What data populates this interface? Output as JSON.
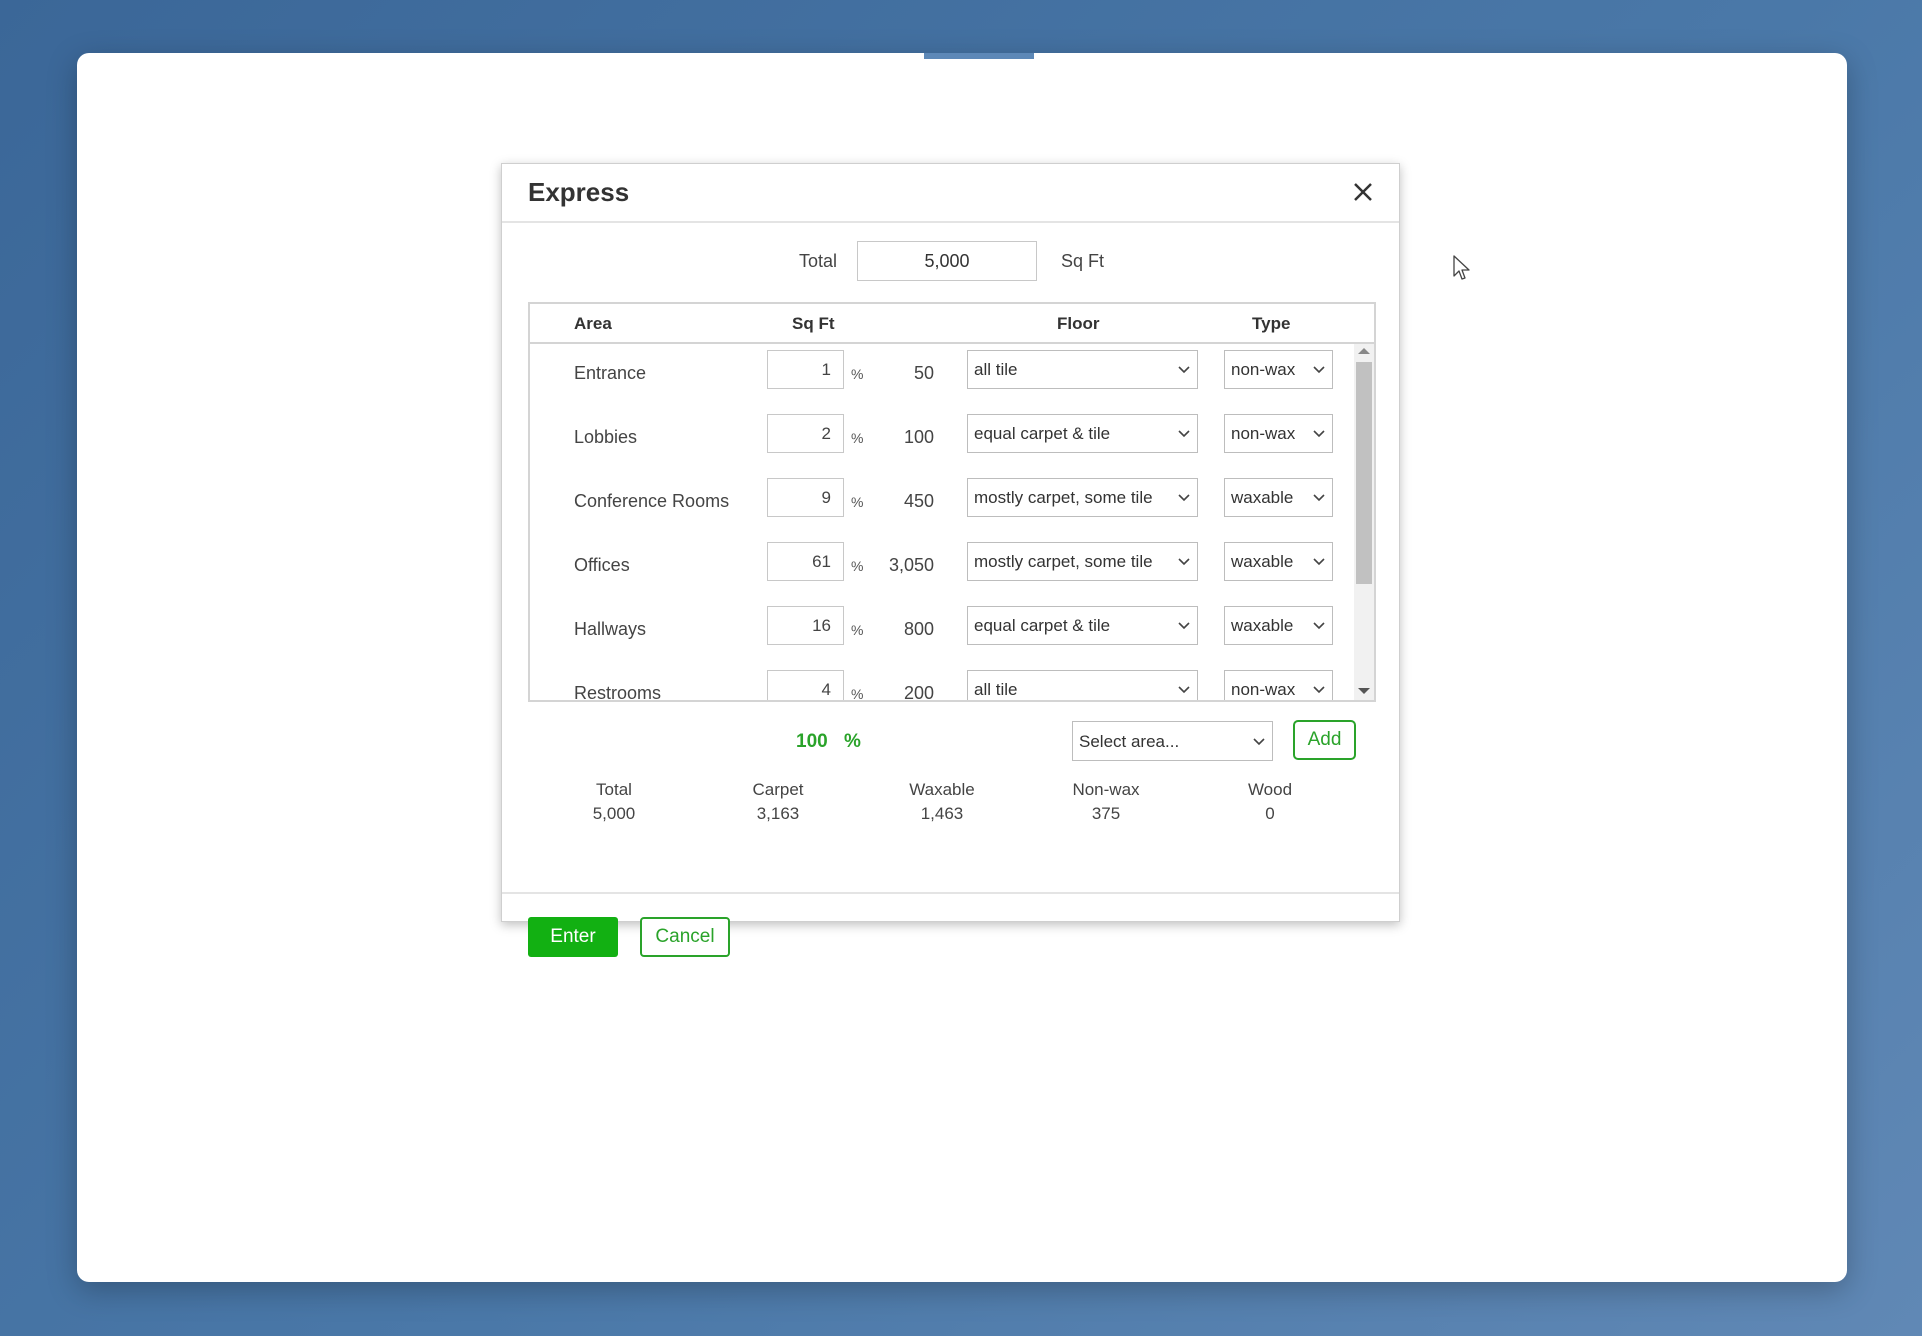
{
  "dialog": {
    "title": "Express",
    "total_label": "Total",
    "total_value": "5,000",
    "total_unit": "Sq Ft"
  },
  "table": {
    "headers": {
      "area": "Area",
      "sqft": "Sq Ft",
      "floor": "Floor",
      "type": "Type"
    },
    "rows": [
      {
        "area": "Entrance",
        "percent": "1",
        "percent_sign": "%",
        "sqft": "50",
        "floor": "all tile",
        "type": "non-wax"
      },
      {
        "area": "Lobbies",
        "percent": "2",
        "percent_sign": "%",
        "sqft": "100",
        "floor": "equal carpet & tile",
        "type": "non-wax"
      },
      {
        "area": "Conference Rooms",
        "percent": "9",
        "percent_sign": "%",
        "sqft": "450",
        "floor": "mostly carpet, some tile",
        "type": "waxable"
      },
      {
        "area": "Offices",
        "percent": "61",
        "percent_sign": "%",
        "sqft": "3,050",
        "floor": "mostly carpet, some tile",
        "type": "waxable"
      },
      {
        "area": "Hallways",
        "percent": "16",
        "percent_sign": "%",
        "sqft": "800",
        "floor": "equal carpet & tile",
        "type": "waxable"
      },
      {
        "area": "Restrooms",
        "percent": "4",
        "percent_sign": "%",
        "sqft": "200",
        "floor": "all tile",
        "type": "non-wax"
      }
    ]
  },
  "summary": {
    "percent_total": "100",
    "percent_sign": "%",
    "area_select_placeholder": "Select area...",
    "add_label": "Add"
  },
  "stats": [
    {
      "label": "Total",
      "value": "5,000"
    },
    {
      "label": "Carpet",
      "value": "3,163"
    },
    {
      "label": "Waxable",
      "value": "1,463"
    },
    {
      "label": "Non-wax",
      "value": "375"
    },
    {
      "label": "Wood",
      "value": "0"
    }
  ],
  "buttons": {
    "enter": "Enter",
    "cancel": "Cancel"
  },
  "colors": {
    "accent_green": "#12b012",
    "background_blue": "#3b6798"
  }
}
